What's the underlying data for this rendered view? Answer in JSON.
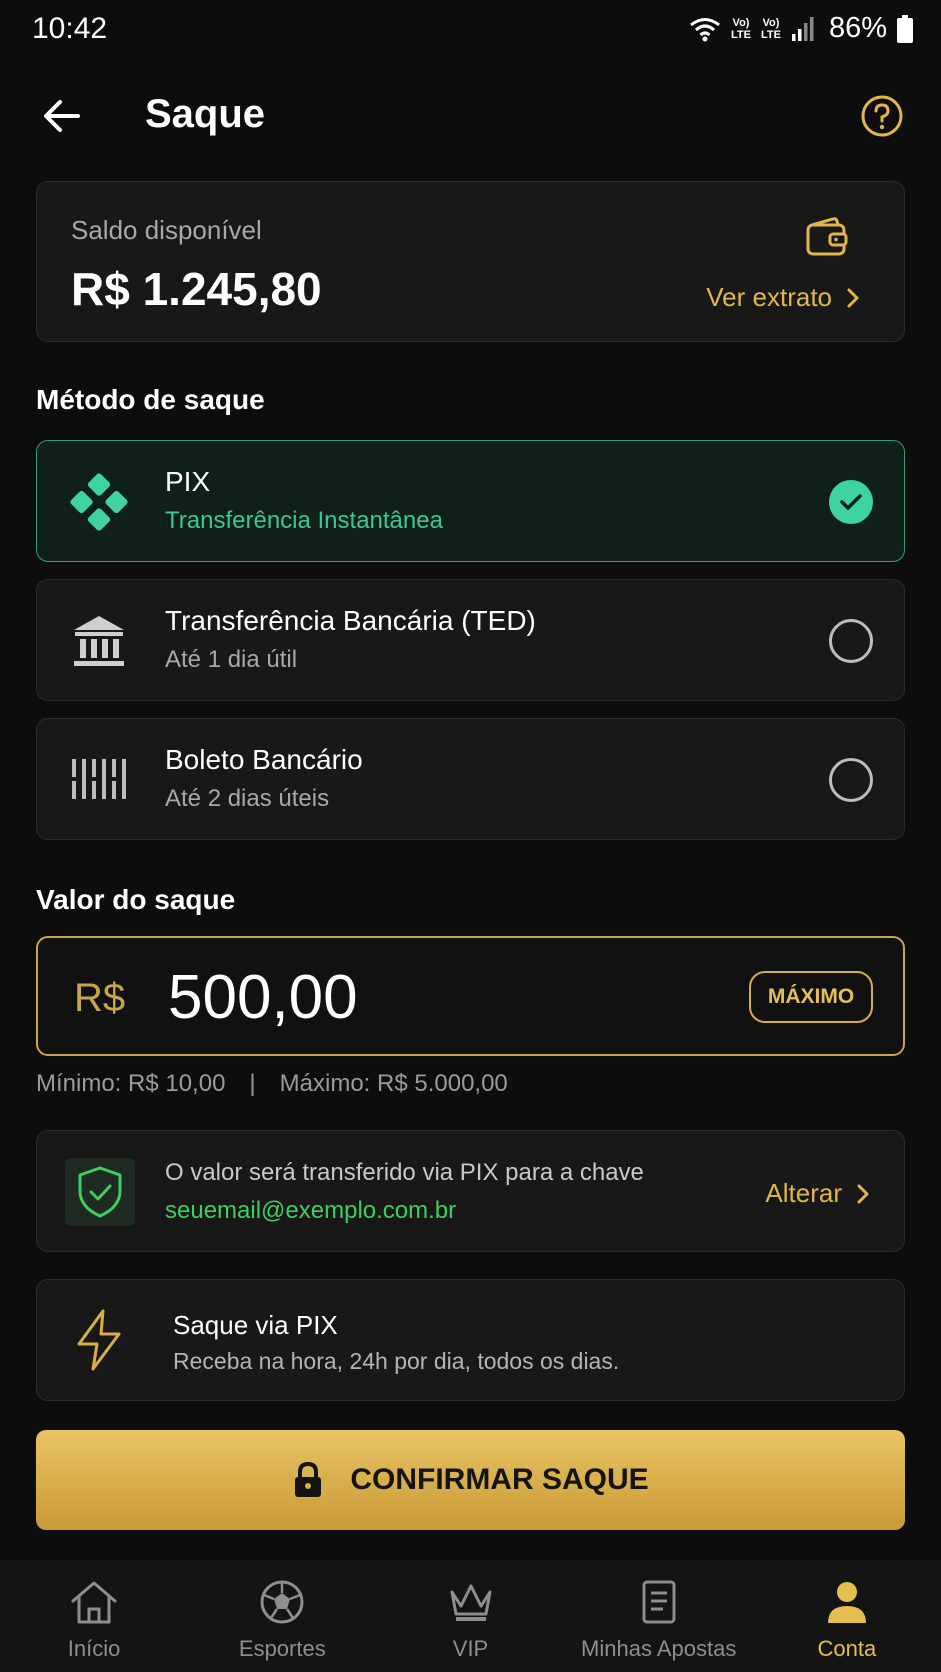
{
  "status_bar": {
    "time": "10:42",
    "volte_1": "Vo)\nLTE",
    "volte_2": "Vo)\nLTE",
    "battery": "86%"
  },
  "header": {
    "title": "Saque",
    "back_icon": "arrow-left-icon",
    "help_icon": "question-circle-icon"
  },
  "balance": {
    "label": "Saldo disponível",
    "value": "R$ 1.245,80",
    "link": "Ver extrato"
  },
  "methods": {
    "title": "Método de saque",
    "items": [
      {
        "name": "PIX",
        "desc": "Transferência Instantânea",
        "icon": "pix-icon",
        "selected": true
      },
      {
        "name": "Transferência Bancária (TED)",
        "desc": "Até 1 dia útil",
        "icon": "bank-icon",
        "selected": false
      },
      {
        "name": "Boleto Bancário",
        "desc": "Até 2 dias úteis",
        "icon": "barcode-icon",
        "selected": false
      }
    ]
  },
  "amount": {
    "title": "Valor do saque",
    "currency": "R$",
    "value": "500,00",
    "max_button": "MÁXIMO",
    "min_text": "Mínimo: R$ 10,00",
    "separator": "|",
    "max_text": "Máximo: R$ 5.000,00"
  },
  "pix_destination": {
    "text": "O valor será transferido via PIX para a chave",
    "key": "seuemail@exemplo.com.br",
    "change": "Alterar"
  },
  "info": {
    "title": "Saque via PIX",
    "desc": "Receba na hora, 24h por dia, todos os dias."
  },
  "confirm_button": "CONFIRMAR SAQUE",
  "nav": {
    "items": [
      {
        "label": "Início",
        "icon": "home-icon",
        "active": false
      },
      {
        "label": "Esportes",
        "icon": "soccer-ball-icon",
        "active": false
      },
      {
        "label": "VIP",
        "icon": "crown-icon",
        "active": false
      },
      {
        "label": "Minhas Apostas",
        "icon": "ticket-icon",
        "active": false
      },
      {
        "label": "Conta",
        "icon": "user-icon",
        "active": true
      }
    ]
  },
  "colors": {
    "accent_gold": "#e2b64b",
    "pix_green": "#3fd3a2",
    "background": "#0d0d0d"
  }
}
